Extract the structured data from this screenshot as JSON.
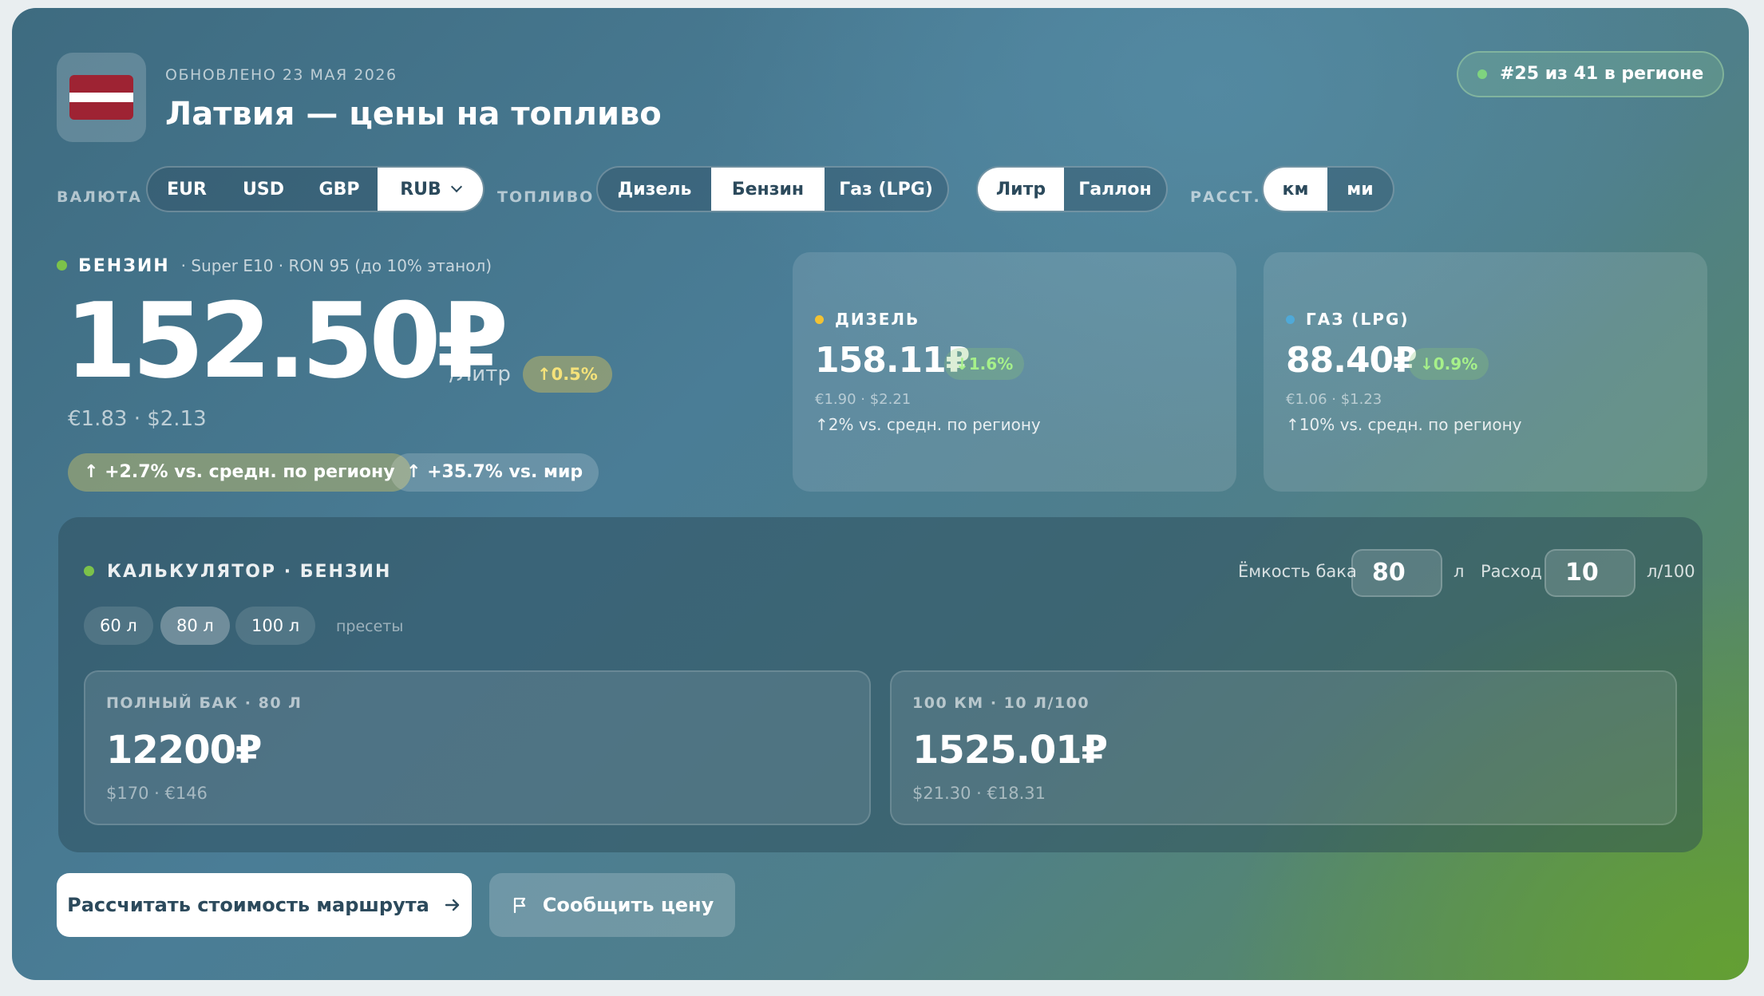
{
  "header": {
    "updated": "ОБНОВЛЕНО 23 МАЯ 2026",
    "title": "Латвия — цены на топливо",
    "rank": "#25 из 41 в регионе"
  },
  "controls": {
    "currency_label": "ВАЛЮТА",
    "currencies": [
      "EUR",
      "USD",
      "GBP",
      "RUB"
    ],
    "currency_selected": "RUB",
    "fuel_label": "ТОПЛИВО",
    "fuels": [
      "Дизель",
      "Бензин",
      "Газ (LPG)"
    ],
    "fuel_selected": "Бензин",
    "units": [
      "Литр",
      "Галлон"
    ],
    "unit_selected": "Литр",
    "distance_label": "РАССТ.",
    "distances": [
      "км",
      "ми"
    ],
    "distance_selected": "км"
  },
  "main": {
    "fuel_name": "БЕНЗИН",
    "fuel_sub": "· Super E10 · RON 95 (до 10% этанол)",
    "price": "152.50₽",
    "per": "/Литр",
    "change": "↑0.5%",
    "equivalents": "€1.83 · $2.13",
    "vs_region": "↑ +2.7% vs. средн. по региону",
    "vs_world": "↑ +35.7% vs. мир"
  },
  "side_cards": [
    {
      "name": "ДИЗЕЛЬ",
      "dot_color": "#f2c233",
      "price": "158.11₽",
      "change": "↓1.6%",
      "equivalents": "€1.90 · $2.21",
      "compare": "↑2% vs. средн. по региону"
    },
    {
      "name": "ГАЗ (LPG)",
      "dot_color": "#4fa9d8",
      "price": "88.40₽",
      "change": "↓0.9%",
      "equivalents": "€1.06 · $1.23",
      "compare": "↑10% vs. средн. по региону"
    }
  ],
  "calculator": {
    "title": "КАЛЬКУЛЯТОР ·  БЕНЗИН",
    "tank_label": "Ёмкость бака",
    "tank_value": "80",
    "tank_unit": "л",
    "consumption_label": "Расход",
    "consumption_value": "10",
    "consumption_unit": "л/100",
    "presets": [
      "60 л",
      "80 л",
      "100 л"
    ],
    "preset_selected": "80 л",
    "presets_label": "пресеты",
    "full_tank": {
      "label": "ПОЛНЫЙ БАК · 80 Л",
      "value": "12200₽",
      "equivalents": "$170 · €146"
    },
    "per_100km": {
      "label": "100 КМ · 10 Л/100",
      "value": "1525.01₽",
      "equivalents": "$21.30 · €18.31"
    }
  },
  "actions": {
    "route": "Рассчитать стоимость маршрута",
    "report": "Сообщить цену"
  },
  "colors": {
    "accent_green": "#7cc24a",
    "flag_red": "#9e2333"
  }
}
